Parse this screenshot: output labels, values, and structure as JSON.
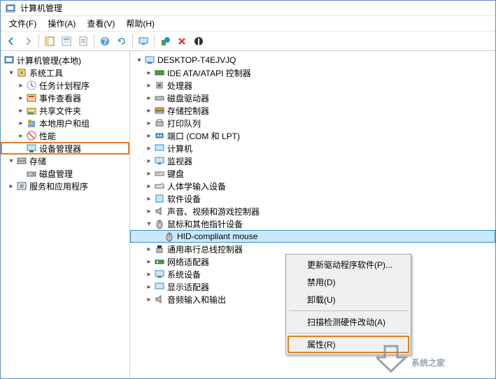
{
  "window": {
    "title": "计算机管理"
  },
  "menu": {
    "file": "文件(F)",
    "action": "操作(A)",
    "view": "查看(V)",
    "help": "帮助(H)"
  },
  "left_tree": {
    "root": "计算机管理(本地)",
    "sys_tools": "系统工具",
    "task_sched": "任务计划程序",
    "event_viewer": "事件查看器",
    "shared_folders": "共享文件夹",
    "local_users": "本地用户和组",
    "performance": "性能",
    "device_mgr": "设备管理器",
    "storage": "存储",
    "disk_mgmt": "磁盘管理",
    "services": "服务和应用程序"
  },
  "right_tree": {
    "root": "DESKTOP-T4EJVJQ",
    "ide": "IDE ATA/ATAPI 控制器",
    "processors": "处理器",
    "disk_drives": "磁盘驱动器",
    "storage_ctrl": "存储控制器",
    "print_queue": "打印队列",
    "ports": "端口 (COM 和 LPT)",
    "computer": "计算机",
    "monitors": "监视器",
    "keyboards": "键盘",
    "hid": "人体学输入设备",
    "software": "软件设备",
    "audio": "声音、视频和游戏控制器",
    "mouse_cat": "鼠标和其他指针设备",
    "hid_mouse": "HID-compliant mouse",
    "usb": "通用串行总线控制器",
    "network": "网络适配器",
    "system_dev": "系统设备",
    "display": "显示适配器",
    "audio_io": "音频输入和输出"
  },
  "context_menu": {
    "update_driver": "更新驱动程序软件(P)...",
    "disable": "禁用(D)",
    "uninstall": "卸载(U)",
    "scan": "扫描检测硬件改动(A)",
    "properties": "属性(R)"
  },
  "watermark": "系统之家"
}
